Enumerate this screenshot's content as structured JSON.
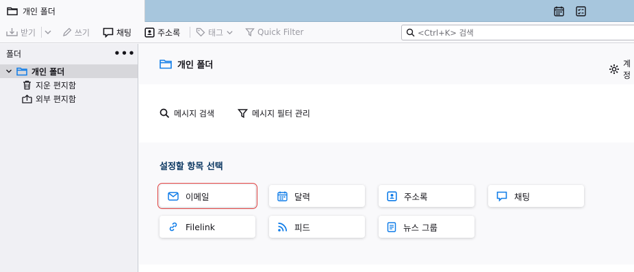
{
  "window": {
    "tab_title": "개인 폴더"
  },
  "toolbar": {
    "get_label": "받기",
    "write_label": "쓰기",
    "chat_label": "채팅",
    "addressbook_label": "주소록",
    "tag_label": "태그",
    "quick_filter_label": "Quick Filter",
    "search_placeholder": "<Ctrl+K> 검색"
  },
  "sidebar": {
    "header": "폴더",
    "more": "•••",
    "folders": [
      {
        "label": "개인 폴더",
        "selected": true
      },
      {
        "label": "지운 편지함"
      },
      {
        "label": "외부 편지함"
      }
    ]
  },
  "main": {
    "account_title": "개인 폴더",
    "account_settings": "계정",
    "actions": [
      {
        "label": "메시지 검색"
      },
      {
        "label": "메시지 필터 관리"
      }
    ],
    "setup_title": "설정할 항목 선택",
    "cards": [
      {
        "label": "이메일",
        "icon": "envelope-icon",
        "highlighted": true
      },
      {
        "label": "달력",
        "icon": "calendar-icon"
      },
      {
        "label": "주소록",
        "icon": "address-book-icon"
      },
      {
        "label": "채팅",
        "icon": "chat-icon"
      },
      {
        "label": "Filelink",
        "icon": "link-icon"
      },
      {
        "label": "피드",
        "icon": "rss-icon"
      },
      {
        "label": "뉴스 그룹",
        "icon": "newsgroup-icon"
      }
    ]
  },
  "colors": {
    "accent": "#0060df",
    "titlebar": "#a7c6dd",
    "highlight": "#e0403f",
    "setup_title": "#0c3862"
  }
}
